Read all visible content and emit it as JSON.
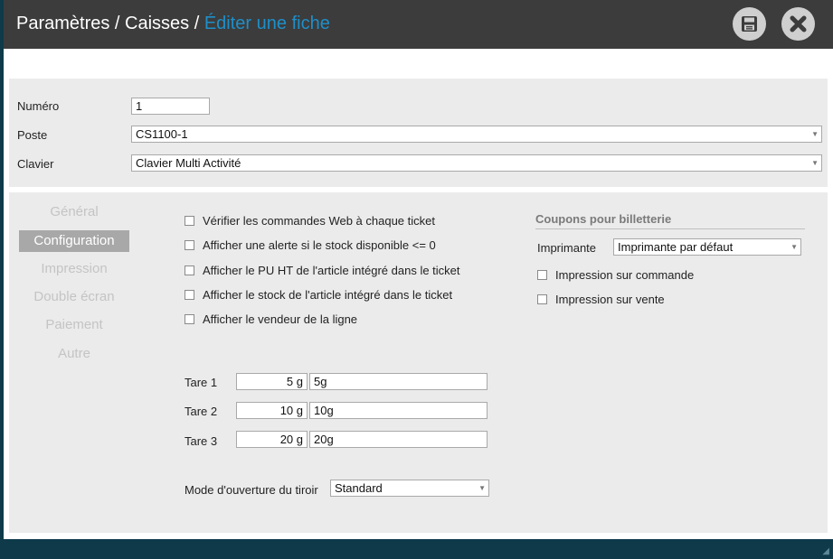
{
  "title": {
    "part1": "Paramètres / Caisses / ",
    "part2": "Éditer une fiche"
  },
  "header_actions": [
    {
      "name": "save-icon"
    },
    {
      "name": "close-icon"
    }
  ],
  "form": {
    "numero": {
      "label": "Numéro",
      "value": "1"
    },
    "poste": {
      "label": "Poste",
      "value": "CS1100-1"
    },
    "clavier": {
      "label": "Clavier",
      "value": "Clavier Multi Activité"
    }
  },
  "nav": [
    {
      "label": "Général",
      "active": false
    },
    {
      "label": "Configuration",
      "active": true
    },
    {
      "label": "Impression",
      "active": false
    },
    {
      "label": "Double écran",
      "active": false
    },
    {
      "label": "Paiement",
      "active": false
    },
    {
      "label": "Autre",
      "active": false
    }
  ],
  "options": [
    {
      "label": "Vérifier les commandes Web à chaque ticket",
      "checked": false
    },
    {
      "label": "Afficher une alerte si le stock disponible <= 0",
      "checked": false
    },
    {
      "label": "Afficher le PU HT de l'article intégré dans le ticket",
      "checked": false
    },
    {
      "label": "Afficher le stock de l'article intégré dans le ticket",
      "checked": false
    },
    {
      "label": "Afficher le vendeur de la ligne",
      "checked": false
    }
  ],
  "tares": [
    {
      "label": "Tare 1",
      "value": "5 g",
      "text": "5g"
    },
    {
      "label": "Tare 2",
      "value": "10 g",
      "text": "10g"
    },
    {
      "label": "Tare 3",
      "value": "20 g",
      "text": "20g"
    }
  ],
  "drawer": {
    "label": "Mode d'ouverture du tiroir",
    "value": "Standard"
  },
  "coupons": {
    "title": "Coupons pour billetterie",
    "printer_label": "Imprimante",
    "printer_value": "Imprimante par défaut",
    "options": [
      {
        "label": "Impression sur commande",
        "checked": false
      },
      {
        "label": "Impression sur vente",
        "checked": false
      }
    ]
  }
}
